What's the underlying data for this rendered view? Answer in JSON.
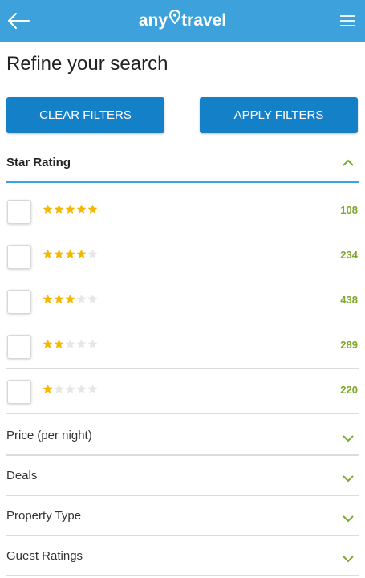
{
  "header": {
    "logo_left": "any",
    "logo_right": "travel",
    "back_icon": "arrow-left-icon",
    "menu_icon": "hamburger-menu-icon",
    "bg_color": "#3da2dc"
  },
  "page_title": "Refine your search",
  "actions": {
    "clear_label": "CLEAR FILTERS",
    "apply_label": "APPLY FILTERS",
    "button_color": "#1480c8"
  },
  "star_rating": {
    "title": "Star Rating",
    "expanded": true,
    "rows": [
      {
        "stars": 5,
        "count": "108",
        "checked": false
      },
      {
        "stars": 4,
        "count": "234",
        "checked": false
      },
      {
        "stars": 3,
        "count": "438",
        "checked": false
      },
      {
        "stars": 2,
        "count": "289",
        "checked": false
      },
      {
        "stars": 1,
        "count": "220",
        "checked": false
      }
    ],
    "star_color": "#f5b800",
    "count_color": "#7da82a"
  },
  "sections": [
    {
      "label": "Price (per night)",
      "expanded": false
    },
    {
      "label": "Deals",
      "expanded": false
    },
    {
      "label": "Property Type",
      "expanded": false
    },
    {
      "label": "Guest Ratings",
      "expanded": false
    }
  ]
}
